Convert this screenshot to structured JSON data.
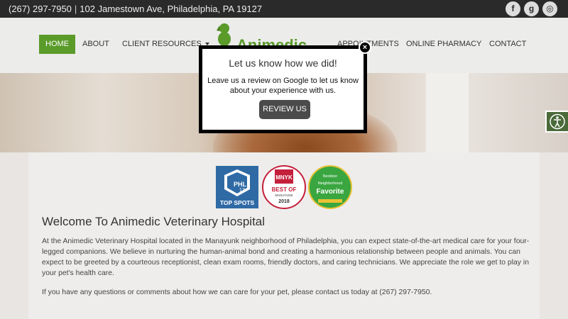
{
  "topbar": {
    "phone": "(267) 297-7950",
    "separator": "|",
    "address": "102 Jamestown Ave, Philadelphia, PA 19127",
    "social": {
      "facebook_glyph": "f",
      "google_glyph": "g",
      "instagram_glyph": "◎"
    }
  },
  "nav": {
    "items": [
      {
        "label": "HOME"
      },
      {
        "label": "ABOUT"
      },
      {
        "label": "CLIENT RESOURCES"
      },
      {
        "label": "APPOINTMENTS"
      },
      {
        "label": "ONLINE PHARMACY"
      },
      {
        "label": "CONTACT"
      }
    ],
    "logo_text": "Animedic"
  },
  "badges": [
    {
      "name": "PHL 17 Top Spots",
      "top": "PHL",
      "num": "17",
      "bottom": "TOP SPOTS"
    },
    {
      "name": "MNYK Best of Manayunk 2018",
      "top": "MNYK",
      "mid": "BEST OF",
      "sub": "MANAYUNK",
      "year": "2018"
    },
    {
      "name": "Nextdoor Neighborhood Favorite",
      "top": "Nextdoor",
      "mid": "Neighborhood",
      "big": "Favorite"
    }
  ],
  "main": {
    "title": "Welcome To Animedic Veterinary Hospital",
    "paragraph1": "At the Animedic Veterinary Hospital located in the Manayunk neighborhood of Philadelphia, you can expect state-of-the-art medical care for your four-legged companions. We believe in nurturing the human-animal bond and creating a harmonious relationship between people and animals. You can expect to be greeted by a courteous receptionist, clean exam rooms, friendly doctors, and caring technicians. We appreciate the role we get to play in your pet's health care.",
    "paragraph2": "If you have any questions or comments about how we can care for your pet, please contact us today at (267) 297-7950."
  },
  "modal": {
    "title": "Let us know how we did!",
    "message": "Leave us a review on Google to let us know about your experience with us.",
    "button": "REVIEW US",
    "close": "×"
  },
  "colors": {
    "accent": "#5a9b2a",
    "topbar": "#2a2a2a",
    "modal_button": "#4b4b4b"
  }
}
